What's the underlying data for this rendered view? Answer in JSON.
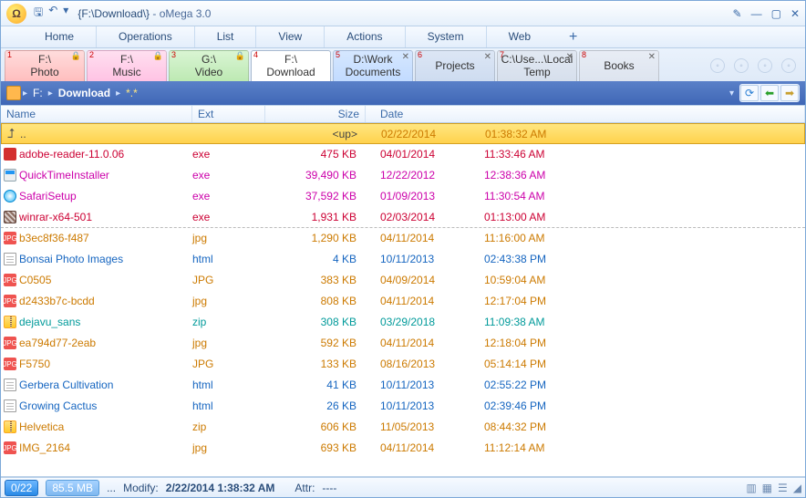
{
  "title": {
    "path": "{F:\\Download\\}",
    "sep": " - ",
    "app": "oMega 3.0"
  },
  "menubar": {
    "items": [
      "Home",
      "Operations",
      "List",
      "View",
      "Actions",
      "System",
      "Web"
    ],
    "add": "+"
  },
  "loctabs": [
    {
      "num": "1",
      "line1": "F:\\",
      "line2": "Photo",
      "cls": "red",
      "locked": true
    },
    {
      "num": "2",
      "line1": "F:\\",
      "line2": "Music",
      "cls": "pink",
      "locked": true
    },
    {
      "num": "3",
      "line1": "G:\\",
      "line2": "Video",
      "cls": "green",
      "locked": true
    },
    {
      "num": "4",
      "line1": "F:\\",
      "line2": "Download",
      "cls": "active",
      "locked": false
    },
    {
      "num": "5",
      "line1": "D:\\Work",
      "line2": "Documents",
      "cls": "blue1",
      "close": true
    },
    {
      "num": "6",
      "line1": "",
      "line2": "Projects",
      "cls": "blue2",
      "close": true
    },
    {
      "num": "7",
      "line1": "C:\\Use...\\Local",
      "line2": "Temp",
      "cls": "blue3",
      "close": true
    },
    {
      "num": "8",
      "line1": "",
      "line2": "Books",
      "cls": "blue4",
      "close": true
    }
  ],
  "breadcrumb": {
    "drive": "F:",
    "folder": "Download",
    "filter": "*.*"
  },
  "columns": {
    "name": "Name",
    "ext": "Ext",
    "size": "Size",
    "date": "Date"
  },
  "uprow": {
    "label": "..",
    "size": "<up>",
    "date": "02/22/2014",
    "time": "01:38:32 AM"
  },
  "files": [
    {
      "icon": "pdf",
      "name": "adobe-reader-11.0.06",
      "ext": "exe",
      "size": "475 KB",
      "date": "04/01/2014",
      "time": "11:33:46 AM",
      "color": "c-red"
    },
    {
      "icon": "exe",
      "name": "QuickTimeInstaller",
      "ext": "exe",
      "size": "39,490 KB",
      "date": "12/22/2012",
      "time": "12:38:36 AM",
      "color": "c-mag"
    },
    {
      "icon": "safari",
      "name": "SafariSetup",
      "ext": "exe",
      "size": "37,592 KB",
      "date": "01/09/2013",
      "time": "11:30:54 AM",
      "color": "c-mag"
    },
    {
      "icon": "rar",
      "name": "winrar-x64-501",
      "ext": "exe",
      "size": "1,931 KB",
      "date": "02/03/2014",
      "time": "01:13:00 AM",
      "color": "c-red",
      "dashed": true
    },
    {
      "icon": "jpg",
      "name": "b3ec8f36-f487",
      "ext": "jpg",
      "size": "1,290 KB",
      "date": "04/11/2014",
      "time": "11:16:00 AM",
      "color": "c-orange"
    },
    {
      "icon": "html",
      "name": "Bonsai Photo Images",
      "ext": "html",
      "size": "4 KB",
      "date": "10/11/2013",
      "time": "02:43:38 PM",
      "color": "c-blue"
    },
    {
      "icon": "jpg",
      "name": "C0505",
      "ext": "JPG",
      "size": "383 KB",
      "date": "04/09/2014",
      "time": "10:59:04 AM",
      "color": "c-orange"
    },
    {
      "icon": "jpg",
      "name": "d2433b7c-bcdd",
      "ext": "jpg",
      "size": "808 KB",
      "date": "04/11/2014",
      "time": "12:17:04 PM",
      "color": "c-orange"
    },
    {
      "icon": "zip",
      "name": "dejavu_sans",
      "ext": "zip",
      "size": "308 KB",
      "date": "03/29/2018",
      "time": "11:09:38 AM",
      "color": "c-teal"
    },
    {
      "icon": "jpg",
      "name": "ea794d77-2eab",
      "ext": "jpg",
      "size": "592 KB",
      "date": "04/11/2014",
      "time": "12:18:04 PM",
      "color": "c-orange"
    },
    {
      "icon": "jpg",
      "name": "F5750",
      "ext": "JPG",
      "size": "133 KB",
      "date": "08/16/2013",
      "time": "05:14:14 PM",
      "color": "c-orange"
    },
    {
      "icon": "html",
      "name": "Gerbera Cultivation",
      "ext": "html",
      "size": "41 KB",
      "date": "10/11/2013",
      "time": "02:55:22 PM",
      "color": "c-blue"
    },
    {
      "icon": "html",
      "name": "Growing Cactus",
      "ext": "html",
      "size": "26 KB",
      "date": "10/11/2013",
      "time": "02:39:46 PM",
      "color": "c-blue"
    },
    {
      "icon": "zip",
      "name": "Helvetica",
      "ext": "zip",
      "size": "606 KB",
      "date": "11/05/2013",
      "time": "08:44:32 PM",
      "color": "c-orange"
    },
    {
      "icon": "jpg",
      "name": "IMG_2164",
      "ext": "jpg",
      "size": "693 KB",
      "date": "04/11/2014",
      "time": "11:12:14 AM",
      "color": "c-orange"
    }
  ],
  "statusbar": {
    "sel": "0/22",
    "size": "85.5 MB",
    "dots": "...",
    "modify_label": "Modify:",
    "modify_value": "2/22/2014 1:38:32 AM",
    "attr_label": "Attr:",
    "attr_value": "----"
  }
}
